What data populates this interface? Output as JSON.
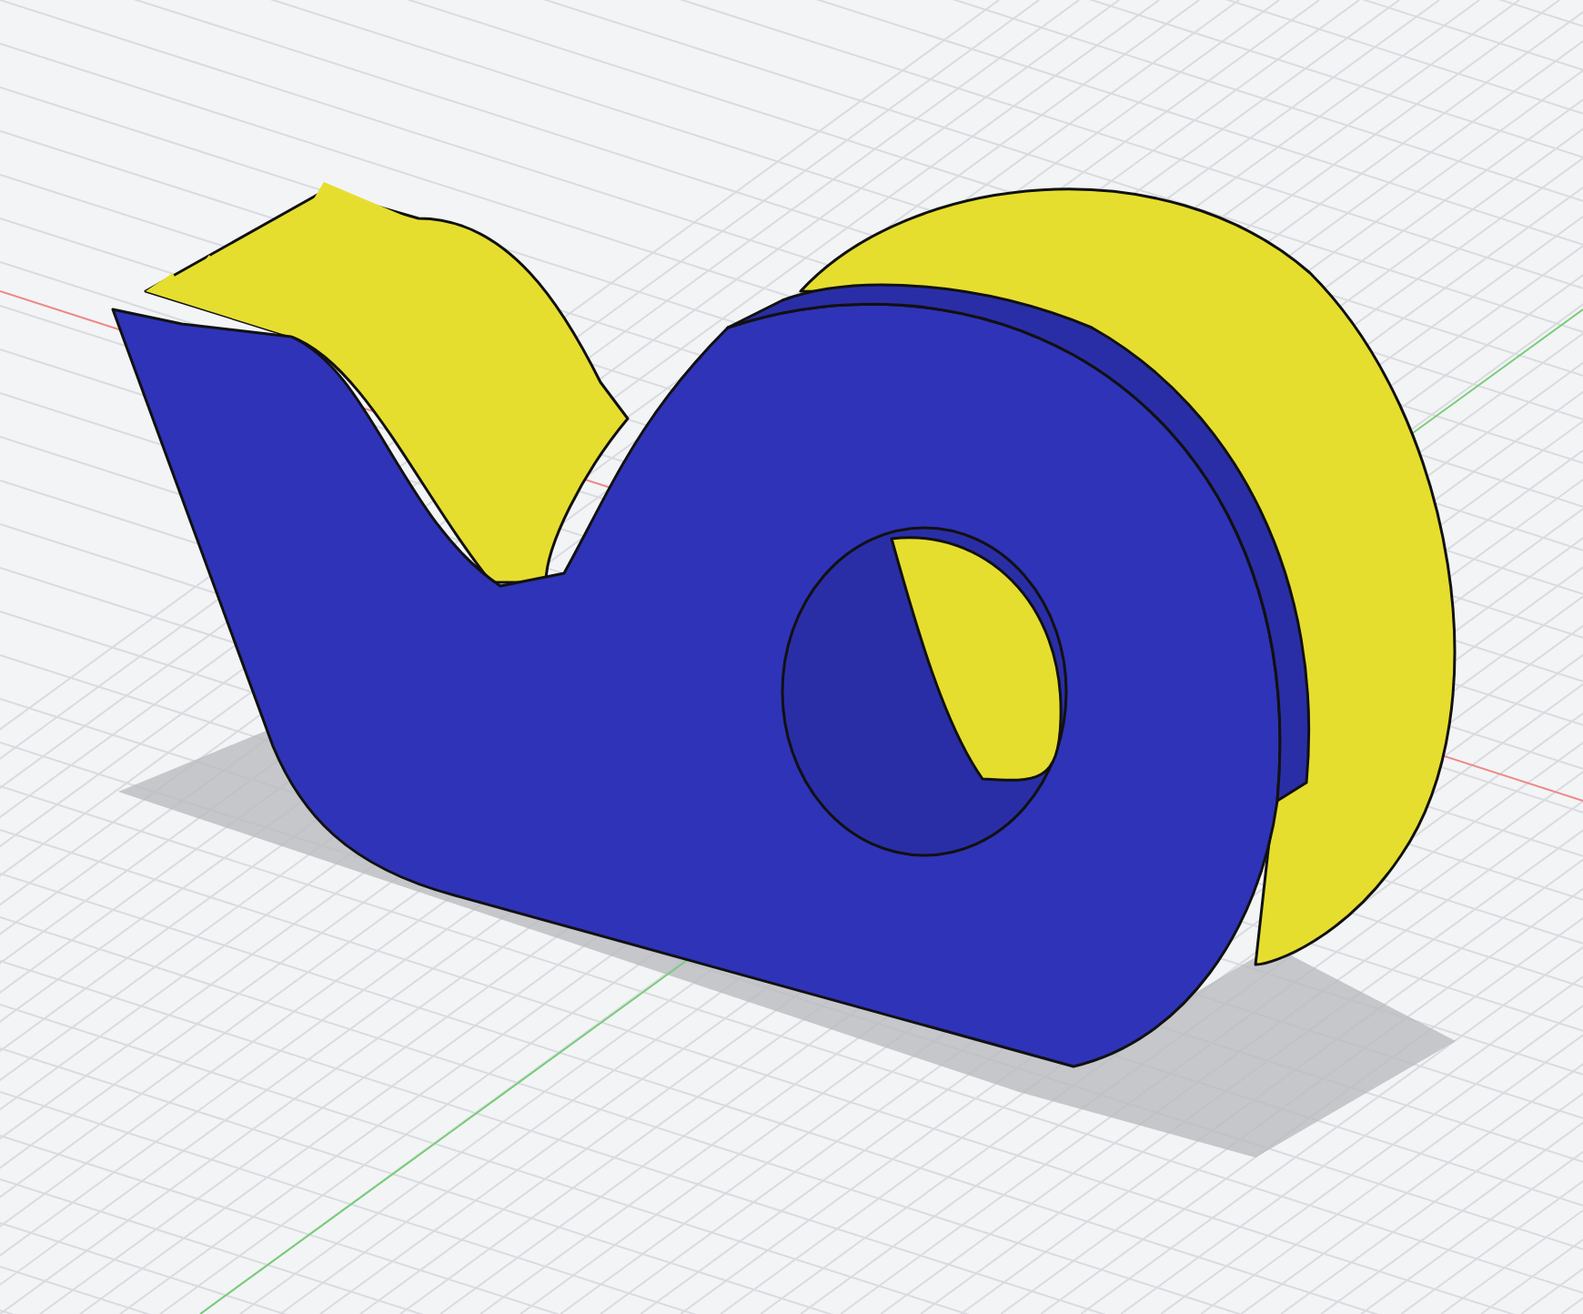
{
  "viewport": {
    "grid_visible": true,
    "shadow_visible": true
  }
}
